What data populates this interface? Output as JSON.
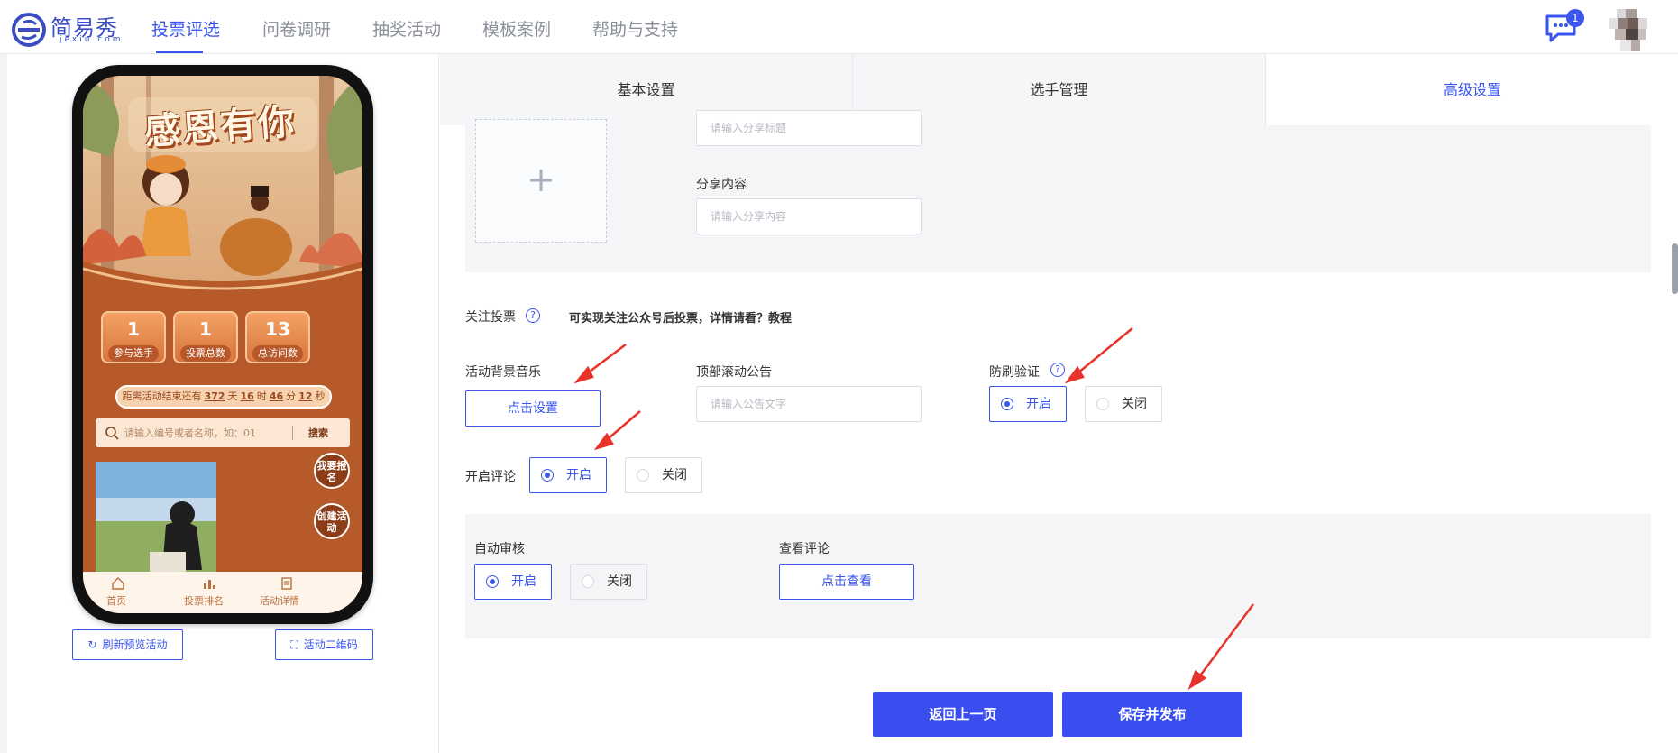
{
  "brand": {
    "name": "简易秀",
    "domain": "jexiu.com",
    "accent": "#3a56ee"
  },
  "nav": {
    "items": [
      "投票评选",
      "问卷调研",
      "抽奖活动",
      "模板案例",
      "帮助与支持"
    ],
    "active_index": 0,
    "message_badge": "1"
  },
  "preview": {
    "banner_title": "感恩有你",
    "stats": [
      {
        "value": "1",
        "label": "参与选手"
      },
      {
        "value": "1",
        "label": "投票总数"
      },
      {
        "value": "13",
        "label": "总访问数"
      }
    ],
    "countdown": {
      "prefix": "距离活动结束还有",
      "days": "372",
      "days_unit": "天",
      "hours": "16",
      "hours_unit": "时",
      "minutes": "46",
      "minutes_unit": "分",
      "seconds": "12",
      "seconds_unit": "秒"
    },
    "search_placeholder": "请输入编号或者名称，如：01",
    "search_button": "搜索",
    "signup_button": "我要报名",
    "create_button": "创建活动",
    "tabs": [
      "首页",
      "投票排名",
      "活动详情"
    ],
    "refresh_button": "刷新预览活动",
    "qrcode_button": "活动二维码"
  },
  "tabs": {
    "items": [
      "基本设置",
      "选手管理",
      "高级设置"
    ],
    "active_index": 2
  },
  "share": {
    "title_placeholder": "请输入分享标题",
    "content_label": "分享内容",
    "content_placeholder": "请输入分享内容",
    "upload_symbol": "+"
  },
  "follow_vote": {
    "label": "关注投票",
    "hint": "可实现关注公众号后投票，详情请看？教程"
  },
  "bg_music": {
    "label": "活动背景音乐",
    "button": "点击设置"
  },
  "announcement": {
    "label": "顶部滚动公告",
    "placeholder": "请输入公告文字"
  },
  "anti_spam": {
    "label": "防刷验证",
    "on": "开启",
    "off": "关闭",
    "selected": "on"
  },
  "comments": {
    "label": "开启评论",
    "on": "开启",
    "off": "关闭",
    "selected": "on"
  },
  "auto_review": {
    "label": "自动审核",
    "on": "开启",
    "off": "关闭",
    "selected": "on"
  },
  "view_comments": {
    "label": "查看评论",
    "button": "点击查看"
  },
  "footer": {
    "back": "返回上一页",
    "publish": "保存并发布"
  }
}
